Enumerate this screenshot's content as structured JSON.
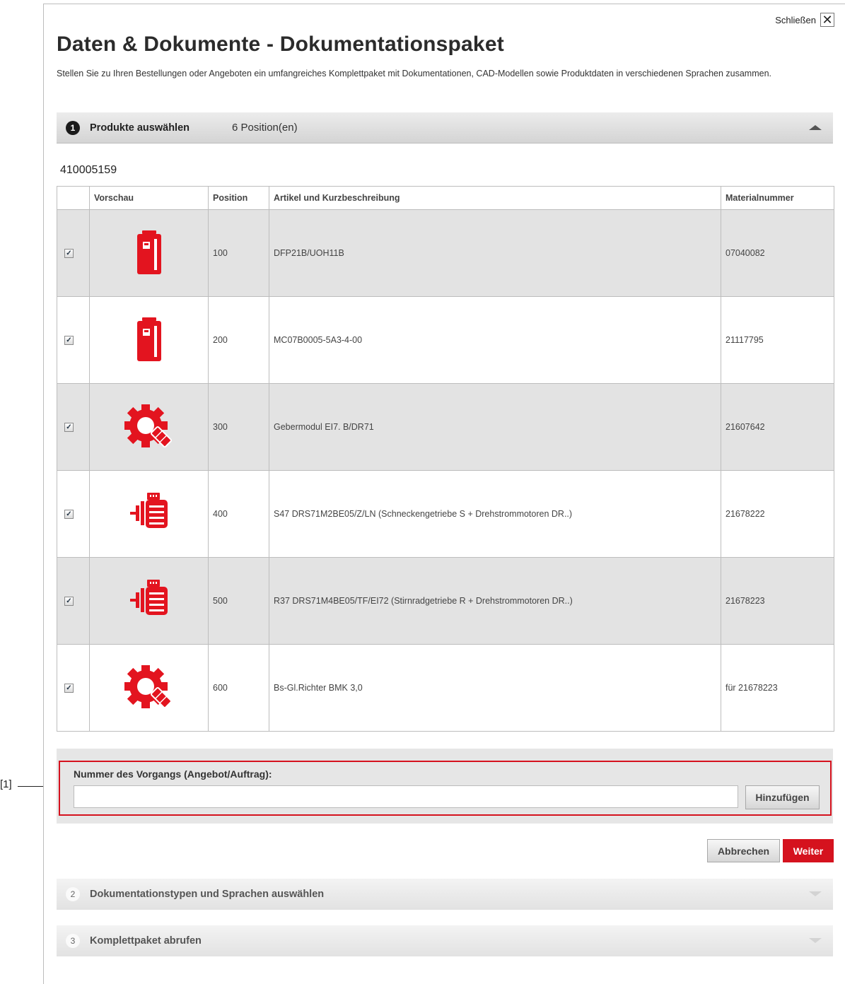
{
  "callout": {
    "label": "[1]"
  },
  "header": {
    "close_label": "Schließen",
    "close_glyph": "✕",
    "title": "Daten & Dokumente - Dokumentationspaket",
    "intro": "Stellen Sie zu Ihren Bestellungen oder Angeboten ein umfangreiches Komplettpaket mit Dokumentationen, CAD-Modellen sowie Produktdaten in verschiedenen Sprachen zusammen."
  },
  "steps": [
    {
      "number": "1",
      "label": "Produkte auswählen",
      "count": "6 Position(en)",
      "expanded": true
    },
    {
      "number": "2",
      "label": "Dokumentationstypen und Sprachen auswählen",
      "expanded": false
    },
    {
      "number": "3",
      "label": "Komplettpaket abrufen",
      "expanded": false
    }
  ],
  "order_id": "410005159",
  "table": {
    "columns": [
      "",
      "Vorschau",
      "Position",
      "Artikel und Kurzbeschreibung",
      "Materialnummer"
    ],
    "rows": [
      {
        "checked": true,
        "icon": "inverter-icon",
        "position": "100",
        "description": "DFP21B/UOH11B",
        "material": "07040082"
      },
      {
        "checked": true,
        "icon": "inverter-icon",
        "position": "200",
        "description": "MC07B0005-5A3-4-00",
        "material": "21117795"
      },
      {
        "checked": true,
        "icon": "gear-encoder-icon",
        "position": "300",
        "description": "Gebermodul EI7. B/DR71",
        "material": "21607642"
      },
      {
        "checked": true,
        "icon": "gearmotor-icon",
        "position": "400",
        "description": "S47 DRS71M2BE05/Z/LN (Schneckengetriebe S + Drehstrommotoren DR..)",
        "material": "21678222"
      },
      {
        "checked": true,
        "icon": "gearmotor-icon",
        "position": "500",
        "description": "R37 DRS71M4BE05/TF/EI72 (Stirnradgetriebe R + Drehstrommotoren DR..)",
        "material": "21678223"
      },
      {
        "checked": true,
        "icon": "gear-encoder-icon",
        "position": "600",
        "description": "Bs-Gl.Richter BMK 3,0",
        "material": "für 21678223"
      }
    ]
  },
  "entry": {
    "label": "Nummer des Vorgangs (Angebot/Auftrag):",
    "value": "",
    "add_button": "Hinzufügen"
  },
  "actions": {
    "cancel": "Abbrechen",
    "next": "Weiter"
  },
  "colors": {
    "accent": "#d5121e",
    "icon": "#e3141f"
  }
}
